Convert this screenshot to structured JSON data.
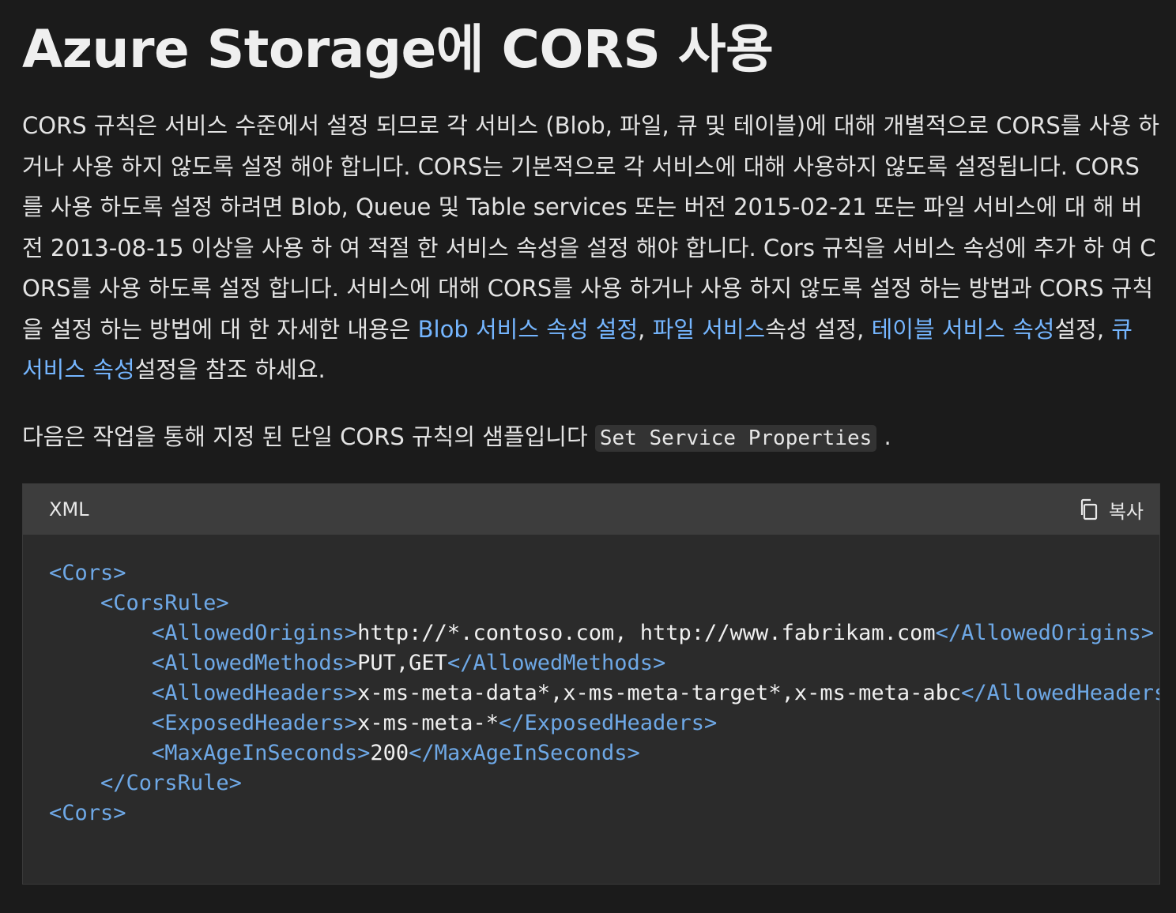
{
  "title": "Azure Storage에 CORS 사용",
  "intro": {
    "text1": "CORS 규칙은 서비스 수준에서 설정 되므로 각 서비스 (Blob, 파일, 큐 및 테이블)에 대해 개별적으로 CORS를 사용 하거나 사용 하지 않도록 설정 해야 합니다. CORS는 기본적으로 각 서비스에 대해 사용하지 않도록 설정됩니다. CORS를 사용 하도록 설정 하려면 Blob, Queue 및 Table services 또는 버전 2015-02-21 또는 파일 서비스에 대 해 버전 2013-08-15 이상을 사용 하 여 적절 한 서비스 속성을 설정 해야 합니다. Cors 규칙을 서비스 속성에 추가 하 여 CORS를 사용 하도록 설정 합니다. 서비스에 대해 CORS를 사용 하거나 사용 하지 않도록 설정 하는 방법과 CORS 규칙을 설정 하는 방법에 대 한 자세한 내용은 ",
    "link_blob": "Blob 서비스 속성 설정",
    "sep1": ", ",
    "link_file": "파일 서비스",
    "text2": "속성 설정, ",
    "link_table": "테이블 서비스 속성",
    "text3": "설정, ",
    "link_queue": "큐 서비스 속성",
    "text4": "설정을 참조 하세요."
  },
  "sample": {
    "text": "다음은 작업을 통해 지정 된 단일 CORS 규칙의 샘플입니다 ",
    "code": "Set Service Properties",
    "suffix": " ."
  },
  "code_block": {
    "language": "XML",
    "copy_label": "복사",
    "lines": [
      {
        "t1": "<Cors>"
      },
      {
        "indent": "    ",
        "t1": "<CorsRule>"
      },
      {
        "indent": "        ",
        "t1": "<AllowedOrigins>",
        "v": "http://*.contoso.com, http://www.fabrikam.com",
        "t2": "</AllowedOrigins>"
      },
      {
        "indent": "        ",
        "t1": "<AllowedMethods>",
        "v": "PUT,GET",
        "t2": "</AllowedMethods>"
      },
      {
        "indent": "        ",
        "t1": "<AllowedHeaders>",
        "v": "x-ms-meta-data*,x-ms-meta-target*,x-ms-meta-abc",
        "t2": "</AllowedHeaders>"
      },
      {
        "indent": "        ",
        "t1": "<ExposedHeaders>",
        "v": "x-ms-meta-*",
        "t2": "</ExposedHeaders>"
      },
      {
        "indent": "        ",
        "t1": "<MaxAgeInSeconds>",
        "v": "200",
        "t2": "</MaxAgeInSeconds>"
      },
      {
        "indent": "    ",
        "t1": "</CorsRule>"
      },
      {
        "t1": "<Cors>"
      }
    ]
  }
}
